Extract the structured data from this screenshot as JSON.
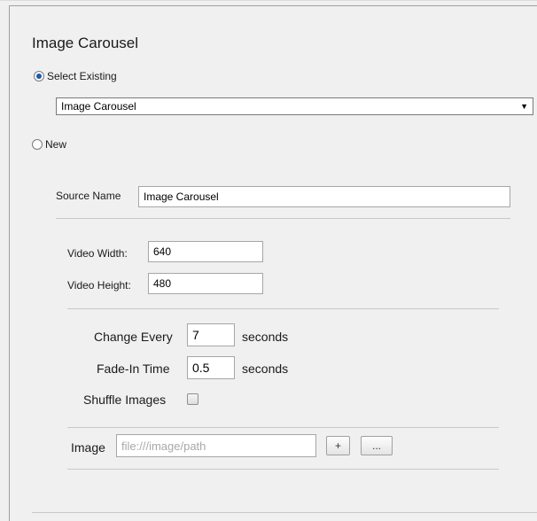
{
  "form": {
    "title": "Image Carousel",
    "select_existing_label": "Select Existing",
    "existing_value": "Image Carousel",
    "new_label": "New",
    "source_name_label": "Source Name",
    "source_name_value": "Image Carousel",
    "video_width_label": "Video Width:",
    "video_width_value": "640",
    "video_height_label": "Video Height:",
    "video_height_value": "480",
    "change_every_label": "Change Every",
    "change_every_value": "7",
    "change_every_unit": "seconds",
    "fade_in_label": "Fade-In Time",
    "fade_in_value": "0.5",
    "fade_in_unit": "seconds",
    "shuffle_label": "Shuffle Images",
    "shuffle_checked": false,
    "image_label": "Image",
    "image_placeholder": "file:///image/path",
    "add_button": "+",
    "browse_button": "..."
  }
}
